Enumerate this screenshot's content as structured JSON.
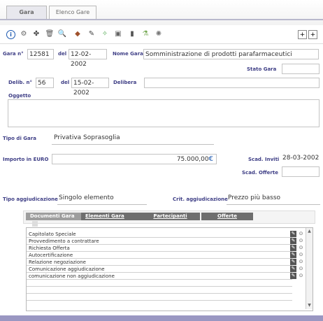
{
  "tabs": [
    {
      "label": "Gara"
    },
    {
      "label": "Elenco Gare"
    }
  ],
  "toolbar": {
    "icons": [
      "info-icon",
      "gear-icon",
      "puzzle-icon",
      "trash-icon",
      "search-icon",
      "box-icon",
      "tools-icon",
      "wrench-icon",
      "cube-icon",
      "battery-icon",
      "flask-icon",
      "settings-icon"
    ],
    "right": [
      "+",
      "+"
    ]
  },
  "form": {
    "gara_no_label": "Gara n°",
    "gara_no": "12581",
    "del_label": "del",
    "gara_date": "12-02-2002",
    "nome_gara_label": "Nome Gara",
    "nome_gara": "Somministrazione di prodotti parafarmaceutici",
    "stato_gara_label": "Stato Gara",
    "stato_gara": "",
    "delib_no_label": "Delib. n°",
    "delib_no": "56",
    "delib_date_label": "del",
    "delib_date": "15-02-2002",
    "delibera_label": "Delibera",
    "delibera": "",
    "oggetto_label": "Oggetto",
    "oggetto": "",
    "tipo_gara_label": "Tipo di Gara",
    "tipo_gara": "Privativa Soprasoglia",
    "importo_label": "Importo in EURO",
    "importo": "75.000,00",
    "currency_symbol": "€",
    "scad_inviti_label": "Scad. Inviti",
    "scad_inviti": "28-03-2002",
    "scad_offerte_label": "Scad. Offerte",
    "scad_offerte": "",
    "tipo_aggiud_label": "Tipo aggiudicazione",
    "tipo_aggiud": "Singolo elemento",
    "crit_aggiud_label": "Crit. aggiudicazione",
    "crit_aggiud": "Prezzo più basso"
  },
  "doc_tabs": [
    {
      "label": "Documenti Gara"
    },
    {
      "label": "Elementi Gara"
    },
    {
      "label": "Partecipanti"
    },
    {
      "label": "Offerte"
    }
  ],
  "documents": [
    {
      "name": "Capitolato Speciale"
    },
    {
      "name": "Provvedimento a contrattare"
    },
    {
      "name": "Richiesta Offerta"
    },
    {
      "name": "Autocertificazione"
    },
    {
      "name": "Relazione negoziazione"
    },
    {
      "name": "Comunicazione aggiudicazione"
    },
    {
      "name": "comunicazione non aggiudicazione"
    }
  ],
  "colors": {
    "label": "#3f3f86",
    "tab_dark": "#6e6e6e",
    "tab_active": "#9e9e9e",
    "footer": "#9a97c2"
  }
}
